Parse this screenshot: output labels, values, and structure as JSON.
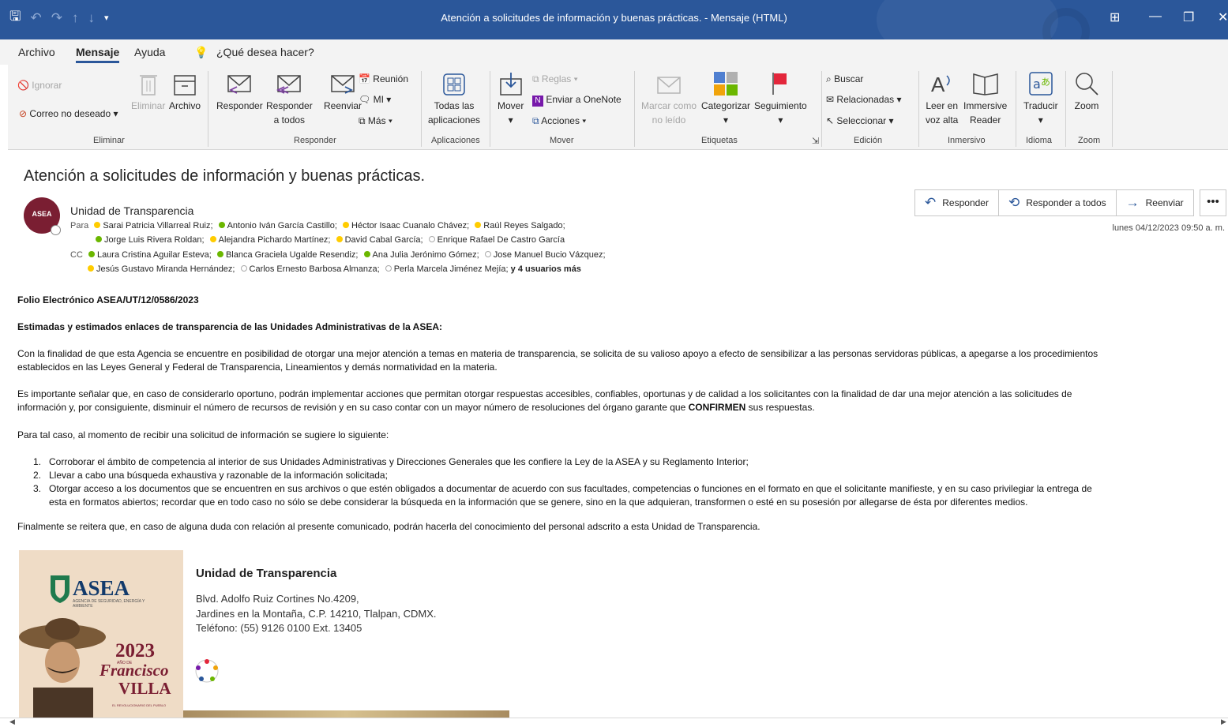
{
  "window": {
    "title": "Atención a solicitudes de información y buenas prácticas.  -  Mensaje (HTML)",
    "icons": [
      "save-icon",
      "undo-icon",
      "redo-icon",
      "arrow-up-icon",
      "arrow-down-icon",
      "customize-icon",
      "ribbon-display-icon",
      "minimize-icon",
      "restore-icon",
      "close-icon"
    ]
  },
  "menu": {
    "archivo": "Archivo",
    "mensaje": "Mensaje",
    "ayuda": "Ayuda",
    "tell_me": "¿Qué desea hacer?"
  },
  "ribbon": {
    "ignorar": "Ignorar",
    "correo_no_deseado": "Correo no deseado",
    "eliminar": "Eliminar",
    "archivo": "Archivo",
    "group_eliminar": "Eliminar",
    "responder": "Responder",
    "responder_a": "Responder",
    "a_todos": "a todos",
    "reenviar": "Reenviar",
    "reunion": "Reunión",
    "mi": "MI",
    "mas": "Más",
    "group_responder": "Responder",
    "todas_las": "Todas las",
    "aplicaciones_l2": "aplicaciones",
    "group_aplicaciones": "Aplicaciones",
    "mover": "Mover",
    "reglas": "Reglas",
    "enviar_onenote": "Enviar a OneNote",
    "acciones": "Acciones",
    "group_mover": "Mover",
    "marcar_como": "Marcar como",
    "no_leido": "no leído",
    "categorizar": "Categorizar",
    "seguimiento": "Seguimiento",
    "group_etiquetas": "Etiquetas",
    "buscar": "Buscar",
    "relacionadas": "Relacionadas",
    "seleccionar": "Seleccionar",
    "group_edicion": "Edición",
    "leer_en": "Leer en",
    "voz_alta": "voz alta",
    "immersive": "Immersive",
    "reader": "Reader",
    "group_inmersivo": "Inmersivo",
    "traducir": "Traducir",
    "group_idioma": "Idioma",
    "zoom": "Zoom",
    "group_zoom": "Zoom"
  },
  "message": {
    "subject": "Atención a solicitudes de información y buenas prácticas.",
    "avatar_text": "ASEA",
    "sender": "Unidad de Transparencia",
    "to_label": "Para",
    "cc_label": "CC",
    "to_line1": [
      {
        "name": "Sarai Patricia Villarreal Ruiz;",
        "status": "away"
      },
      {
        "name": "Antonio Iván García Castillo;",
        "status": "available"
      },
      {
        "name": "Héctor Isaac Cuanalo Chávez;",
        "status": "away"
      },
      {
        "name": "Raúl Reyes Salgado;",
        "status": "away"
      }
    ],
    "to_line2": [
      {
        "name": "Jorge Luis Rivera Roldan;",
        "status": "available"
      },
      {
        "name": "Alejandra Pichardo Martínez;",
        "status": "away"
      },
      {
        "name": "David Cabal García;",
        "status": "away"
      },
      {
        "name": "Enrique Rafael De Castro García",
        "status": "offline"
      }
    ],
    "cc_line1": [
      {
        "name": "Laura Cristina Aguilar Esteva;",
        "status": "available"
      },
      {
        "name": "Blanca Graciela Ugalde Resendiz;",
        "status": "available"
      },
      {
        "name": "Ana Julia Jerónimo Gómez;",
        "status": "available"
      },
      {
        "name": "Jose Manuel Bucio Vázquez;",
        "status": "offline"
      }
    ],
    "cc_line2": [
      {
        "name": "Jesús Gustavo Miranda Hernández;",
        "status": "away"
      },
      {
        "name": "Carlos Ernesto Barbosa Almanza;",
        "status": "offline"
      },
      {
        "name": "Perla Marcela Jiménez Mejía;",
        "status": "offline"
      }
    ],
    "more_users": "y 4 usuarios más",
    "reply": "Responder",
    "reply_all": "Responder a todos",
    "forward": "Reenviar",
    "more_button": "•••",
    "date": "lunes 04/12/2023 09:50 a. m."
  },
  "body": {
    "folio": "Folio Electrónico ASEA/UT/12/0586/2023",
    "greeting": "Estimadas y estimados enlaces de transparencia de las Unidades Administrativas de la ASEA:",
    "p1_l1": "Con la finalidad de que esta Agencia se encuentre en posibilidad de otorgar una mejor atención a temas en materia de transparencia, se solicita de su valioso apoyo a efecto de sensibilizar a las personas servidoras públicas, a apegarse a los procedimientos",
    "p1_l2": "establecidos en las Leyes General y Federal de Transparencia, Lineamientos y demás normatividad en la materia.",
    "p2_l1": "Es importante señalar que, en caso de considerarlo oportuno, podrán implementar acciones que permitan otorgar respuestas accesibles, confiables, oportunas y de calidad a los solicitantes con la finalidad de dar una mejor atención a las solicitudes de",
    "p2_l2a": "información y, por consiguiente, disminuir el número de recursos de revisión y en su caso contar con un mayor número de resoluciones del órgano garante que",
    "p2_bold": "CONFIRMEN",
    "p2_l2b": "sus respuestas.",
    "p3": "Para tal caso, al momento de recibir una solicitud de información se sugiere lo siguiente:",
    "item1_num": "1.",
    "item1": "Corroborar el ámbito de competencia al interior de sus Unidades Administrativas y Direcciones Generales que les confiere la Ley de la ASEA y su Reglamento Interior;",
    "item2_num": "2.",
    "item2": "Llevar a cabo una búsqueda exhaustiva y razonable de la información solicitada;",
    "item3_num": "3.",
    "item3_l1": "Otorgar acceso a los documentos que se encuentren en sus archivos o que estén obligados a documentar de acuerdo con sus facultades, competencias o funciones en el formato en que el solicitante manifieste, y en su caso privilegiar la entrega de",
    "item3_l2": "esta en formatos abiertos; recordar que en todo caso no sólo se debe considerar la búsqueda en la información que se genere, sino en la que adquieran, transformen o esté en su posesión por allegarse de ésta por diferentes medios.",
    "closing": "Finalmente se reitera que, en caso de alguna duda con relación al presente comunicado, podrán hacerla del conocimiento del personal adscrito a esta Unidad de Transparencia."
  },
  "signature": {
    "logo_name": "ASEA",
    "logo_sub": "AGENCIA DE SEGURIDAD, ENERGÍA Y AMBIENTE",
    "year": "2023",
    "year_sub": "AÑO DE",
    "francisco": "Francisco",
    "villa": "VILLA",
    "motto": "EL REVOLUCIONARIO DEL PUEBLO",
    "unit": "Unidad de Transparencia",
    "addr1": "Blvd. Adolfo Ruiz Cortines No.4209,",
    "addr2": "Jardines en la Montaña, C.P. 14210, Tlalpan, CDMX.",
    "phone": "Teléfono: (55) 9126 0100 Ext. 13405"
  },
  "colors": {
    "titlebar": "#2b579a",
    "available": "#6bb700",
    "away": "#ffcc00",
    "avatar": "#7a1e32"
  }
}
